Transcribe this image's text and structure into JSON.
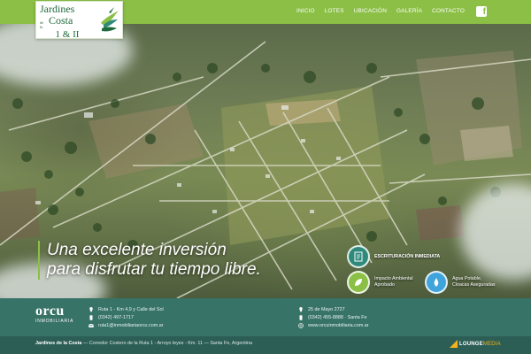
{
  "header": {
    "logo": {
      "line1": "Jardines",
      "small_text": "de la",
      "line2": "Costa",
      "line3": "1 & II"
    },
    "nav": [
      {
        "label": "INICIO"
      },
      {
        "label": "LOTES"
      },
      {
        "label": "UBICACIÓN"
      },
      {
        "label": "GALERÍA"
      },
      {
        "label": "CONTACTO"
      }
    ],
    "social_icon": "facebook-icon",
    "social_glyph": "f"
  },
  "hero": {
    "tagline": {
      "line1": "Una excelente inversión",
      "line2": "para disfrutar tu tiempo libre."
    },
    "features": [
      {
        "icon": "deed-icon",
        "label": "ESCRITURACIÓN INMEDIATA",
        "color": "#2f8a7c"
      },
      {
        "icon": "leaf-icon",
        "label_line1": "Impacto Ambiental",
        "label_line2": "Aprobado",
        "color": "#8bbf45"
      },
      {
        "icon": "water-drop-icon",
        "label_line1": "Agua Potable,",
        "label_line2": "Cloacas Aseguradas",
        "color": "#3fa3dc"
      }
    ]
  },
  "infobar": {
    "brand": {
      "name": "orcu",
      "subtitle": "INMOBILIARIA"
    },
    "contact_left": [
      {
        "icon": "location-pin-icon",
        "text": "Ruta 1 - Km 4,9 y Calle del Sol"
      },
      {
        "icon": "phone-icon",
        "text": "(0342) 497-1717"
      },
      {
        "icon": "email-icon",
        "text": "ruta1@inmobiliariaorcu.com.ar"
      }
    ],
    "contact_right": [
      {
        "icon": "location-pin-icon",
        "text": "25 de Mayo 2727"
      },
      {
        "icon": "phone-icon",
        "text": "(0342) 455-8888 · Santa Fe"
      },
      {
        "icon": "globe-icon",
        "text": "www.orcuinmobiliaria.com.ar"
      }
    ]
  },
  "footer": {
    "brand": "Jardines de la Costa",
    "text": " — Corredor Costero de la Ruta 1 - Arroyo leyes - Km. 11 — Santa Fe, Argentina",
    "credit_bold": "LOUNGE",
    "credit_light": "MEDIA"
  },
  "colors": {
    "brand_green": "#8bbf45",
    "logo_green": "#1f6b3c",
    "teal_bar": "#38786e",
    "footer_teal": "#2c5e56",
    "feature_deed": "#2f8a7c",
    "feature_leaf": "#8bbf45",
    "feature_water": "#3fa3dc"
  }
}
